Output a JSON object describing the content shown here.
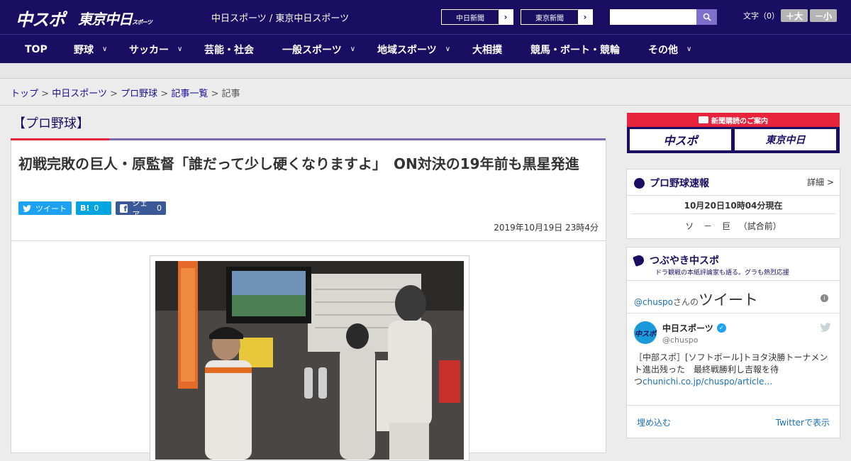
{
  "header": {
    "logo_chuspo": "中スポ",
    "logo_tokyo": "東京中日",
    "logo_tokyo_small": "スポーツ",
    "site_name": "中日スポーツ / 東京中日スポーツ",
    "paper_links": [
      {
        "label": "中日新聞",
        "arrow": "›"
      },
      {
        "label": "東京新聞",
        "arrow": "›"
      }
    ],
    "search_placeholder": "",
    "font_size_label": "文字（0）",
    "font_bigger": "＋大",
    "font_smaller": "－小"
  },
  "nav": [
    {
      "label": "TOP",
      "has_menu": false
    },
    {
      "label": "野球",
      "has_menu": true
    },
    {
      "label": "サッカー",
      "has_menu": true
    },
    {
      "label": "芸能・社会",
      "has_menu": false
    },
    {
      "label": "一般スポーツ",
      "has_menu": true
    },
    {
      "label": "地域スポーツ",
      "has_menu": true
    },
    {
      "label": "大相撲",
      "has_menu": false
    },
    {
      "label": "競馬・ボート・競輪",
      "has_menu": false
    },
    {
      "label": "その他",
      "has_menu": true
    }
  ],
  "breadcrumb": {
    "items": [
      "トップ",
      "中日スポーツ",
      "プロ野球",
      "記事一覧"
    ],
    "current": "記事",
    "separator": ">"
  },
  "article": {
    "category": "【プロ野球】",
    "headline": "初戦完敗の巨人・原監督「誰だって少し硬くなりますよ」　ON対決の19年前も黒星発進",
    "share": {
      "tweet_label": "ツイート",
      "hatena_label": "B!",
      "hatena_count": "0",
      "facebook_label": "シェア",
      "facebook_count": "0"
    },
    "date": "2019年10月19日 23時4分"
  },
  "sidebar": {
    "subscribe_title": "新聞購読のご案内",
    "subscribe_chuspo": "中スポ",
    "subscribe_tokyo": "東京中日",
    "baseball_title": "プロ野球速報",
    "baseball_more": "詳細 >",
    "baseball_time": "10月20日10時04分現在",
    "baseball_game": {
      "home": "ソ",
      "dash": "－",
      "away": "巨",
      "status": "（試合前）"
    },
    "tsubuyaki_title": "つぶやき中スポ",
    "tsubuyaki_sub": "ドラ観戦の本紙評論家も語る。グラも熱烈応援",
    "twitter": {
      "handle_prefix": "@chuspo",
      "handle_suffix": "さんの",
      "heading": "ツイート",
      "account_name": "中日スポーツ",
      "account_handle": "@chuspo",
      "tweet_line1": "［中部スポ］[ソフトボール]トヨタ決勝トーナメン",
      "tweet_line2": "ト進出残った　最終戦勝利し吉報を待",
      "tweet_line3_pre": "つ",
      "tweet_link": "chunichi.co.jp/chuspo/article…",
      "embed_label": "埋め込む",
      "view_label": "Twitterで表示"
    }
  },
  "colors": {
    "brand_navy": "#1a0e63",
    "accent_red": "#e8243c",
    "twitter_blue": "#1da1f2",
    "hatena_blue": "#00a4de",
    "facebook_blue": "#3b5998"
  }
}
